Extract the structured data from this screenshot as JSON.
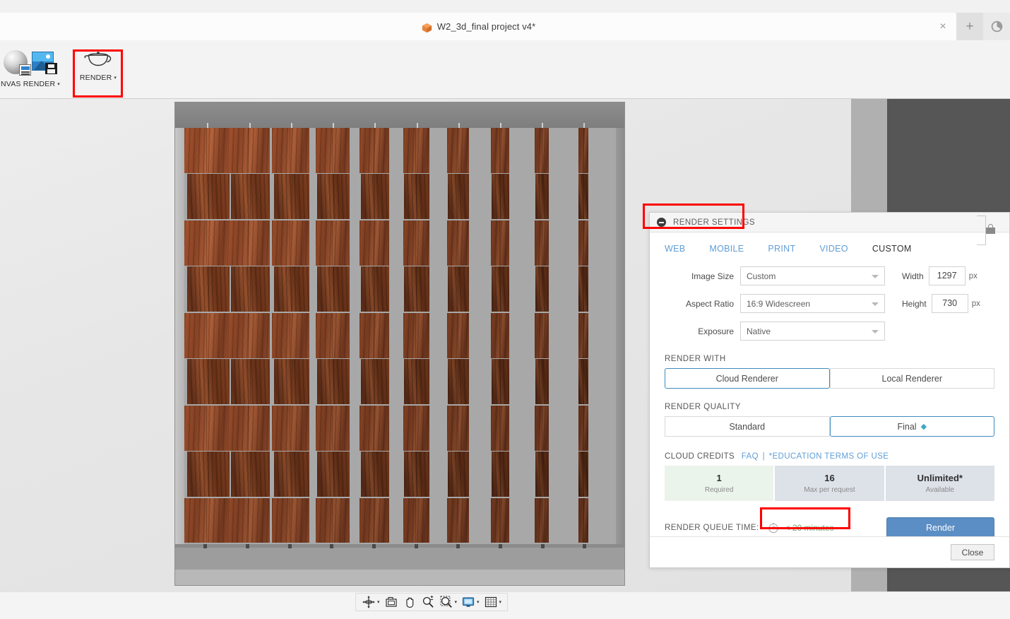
{
  "window": {
    "title": "W2_3d_final project v4*",
    "title_icon": "cube-icon",
    "close_label": "×",
    "new_tab_label": "+",
    "app_menu_icon": "circle-swirl-icon"
  },
  "ribbon": {
    "items": [
      {
        "label": "NVAS RENDER",
        "caret": "▾",
        "icon": "render-material-sphere-icon"
      },
      {
        "label": "RENDER",
        "caret": "▾",
        "icon": "teapot-icon"
      }
    ],
    "canvas_render_label": "NVAS RENDER",
    "render_label": "RENDER",
    "caret": "▾",
    "save_image_icon": "save-image-icon"
  },
  "viewport": {
    "model_description": "wooden folding panel screen",
    "nav_toolbar": [
      {
        "name": "orbit-tool",
        "icon": "orbit-icon",
        "has_caret": true
      },
      {
        "name": "look-at-tool",
        "icon": "camera-icon",
        "has_caret": false
      },
      {
        "name": "pan-tool",
        "icon": "hand-icon",
        "has_caret": false
      },
      {
        "name": "zoom-tool",
        "icon": "zoom-plus-minus-icon",
        "has_caret": false
      },
      {
        "name": "zoom-window-tool",
        "icon": "zoom-window-icon",
        "has_caret": true
      },
      {
        "name": "display-settings-tool",
        "icon": "monitor-icon",
        "has_caret": true
      },
      {
        "name": "grid-settings-tool",
        "icon": "grid-icon",
        "has_caret": true
      }
    ]
  },
  "render_settings": {
    "header": "RENDER SETTINGS",
    "collapse_icon": "minus-circle-icon",
    "tabs": [
      {
        "label": "WEB",
        "active": false
      },
      {
        "label": "MOBILE",
        "active": false
      },
      {
        "label": "PRINT",
        "active": false
      },
      {
        "label": "VIDEO",
        "active": false
      },
      {
        "label": "CUSTOM",
        "active": true
      }
    ],
    "fields": {
      "image_size": {
        "label": "Image Size",
        "value": "Custom"
      },
      "aspect_ratio": {
        "label": "Aspect Ratio",
        "value": "16:9 Widescreen"
      },
      "exposure": {
        "label": "Exposure",
        "value": "Native"
      },
      "width": {
        "label": "Width",
        "value": "1297",
        "unit": "px"
      },
      "height": {
        "label": "Height",
        "value": "730",
        "unit": "px"
      },
      "lock_icon": "lock-icon"
    },
    "render_with": {
      "title": "RENDER WITH",
      "options": [
        {
          "label": "Cloud Renderer",
          "selected": true
        },
        {
          "label": "Local Renderer",
          "selected": false
        }
      ]
    },
    "render_quality": {
      "title": "RENDER QUALITY",
      "options": [
        {
          "label": "Standard",
          "selected": false
        },
        {
          "label": "Final",
          "selected": true,
          "gem_icon": "◈"
        }
      ]
    },
    "cloud_credits": {
      "title": "CLOUD CREDITS",
      "faq_link": "FAQ",
      "separator": "|",
      "terms_link": "*EDUCATION TERMS OF USE",
      "boxes": [
        {
          "value": "1",
          "sub": "Required",
          "highlight": "green"
        },
        {
          "value": "16",
          "sub": "Max per request",
          "highlight": "gray"
        },
        {
          "value": "Unlimited*",
          "sub": "Available",
          "highlight": "gray"
        }
      ]
    },
    "queue": {
      "label": "RENDER QUEUE TIME:",
      "clock_icon": "clock-icon",
      "value": "< 20 minutes"
    },
    "render_button": "Render",
    "close_button": "Close"
  },
  "colors": {
    "accent_blue": "#5f9ed6",
    "render_button": "#5b8ec4",
    "selected_border": "#3e8bbd",
    "queue_green": "#6fae71",
    "credit_green_bg": "#ebf4ea",
    "credit_gray_bg": "#dde1e8",
    "highlight_red": "#ff0000",
    "wood_light": "#a8552f",
    "wood_dark": "#6e3419"
  }
}
